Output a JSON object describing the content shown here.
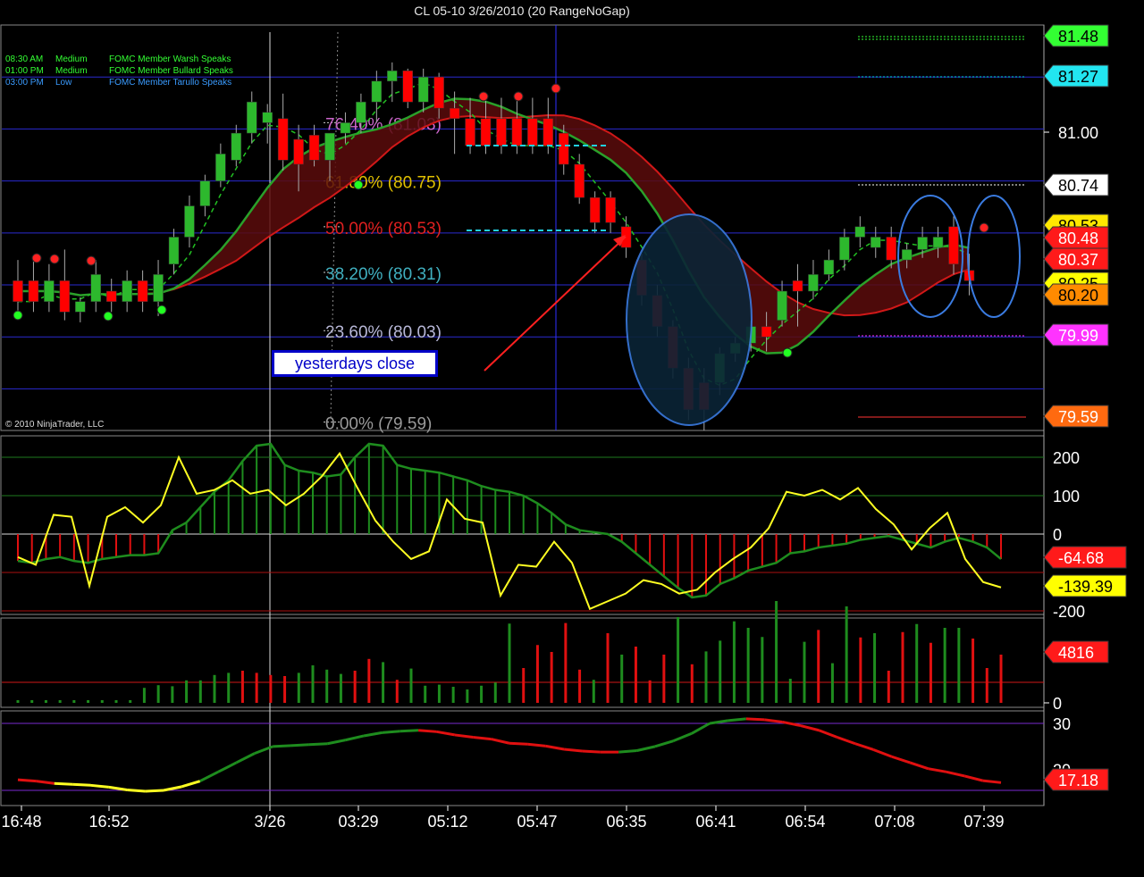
{
  "title": "CL 05-10  3/26/2010 (20 RangeNoGap)",
  "copyright": "© 2010 NinjaTrader, LLC",
  "yesterdays_close_label": "yesterdays close",
  "events": [
    {
      "time": "08:30 AM",
      "impact": "Medium",
      "text": "FOMC Member Warsh Speaks",
      "color": "#33ff33"
    },
    {
      "time": "01:00 PM",
      "impact": "Medium",
      "text": "FOMC Member Bullard Speaks",
      "color": "#33ff33"
    },
    {
      "time": "03:00 PM",
      "impact": "Low",
      "text": "FOMC Member Tarullo Speaks",
      "color": "#3a9bff"
    }
  ],
  "colors": {
    "up": "#2db82d",
    "down": "#ff0000",
    "accent_blue": "#3a9bff",
    "grid": "#2a2ad0"
  },
  "chart_data": [
    {
      "panel": "price",
      "type": "candlestick",
      "yticks": [
        "81.00",
        "79.75"
      ],
      "ylim": [
        79.55,
        81.5
      ],
      "xticks": [
        "16:48",
        "16:52",
        "3/26",
        "03:29",
        "05:12",
        "05:47",
        "06:35",
        "06:41",
        "06:54",
        "07:08",
        "07:39"
      ],
      "fib_levels": [
        {
          "label": "76.40% (81.03)",
          "value": 81.03,
          "color": "#cc66cc"
        },
        {
          "label": "61.80% (80.75)",
          "value": 80.75,
          "color": "#e0c000"
        },
        {
          "label": "50.00% (80.53)",
          "value": 80.53,
          "color": "#e02020"
        },
        {
          "label": "38.20% (80.31)",
          "value": 80.31,
          "color": "#40b0c0"
        },
        {
          "label": "23.60% (80.03)",
          "value": 80.03,
          "color": "#b8b8d8"
        },
        {
          "label": "0.00% (79.59)",
          "value": 79.59,
          "color": "#9a9a9a"
        }
      ],
      "price_labels": [
        {
          "text": "81.48",
          "bg": "#33ff33",
          "fg": "#000"
        },
        {
          "text": "81.27",
          "bg": "#22e5f0",
          "fg": "#000"
        },
        {
          "text": "81.00",
          "bg": "none",
          "fg": "#fff"
        },
        {
          "text": "80.74",
          "bg": "#ffffff",
          "fg": "#000"
        },
        {
          "text": "80.53",
          "bg": "#ffe800",
          "fg": "#000"
        },
        {
          "text": "80.48",
          "bg": "#ff1a1a",
          "fg": "#fff"
        },
        {
          "text": "80.37",
          "bg": "#ff1a1a",
          "fg": "#fff"
        },
        {
          "text": "80.25",
          "bg": "#ffff00",
          "fg": "#000"
        },
        {
          "text": "80.20",
          "bg": "#ff8a00",
          "fg": "#000"
        },
        {
          "text": "79.99",
          "bg": "#ff33ff",
          "fg": "#fff"
        },
        {
          "text": "79.59",
          "bg": "#ff6a10",
          "fg": "#fff"
        }
      ],
      "candles": [
        [
          80.27,
          80.37,
          80.12,
          80.17
        ],
        [
          80.27,
          80.37,
          80.12,
          80.17
        ],
        [
          80.17,
          80.35,
          80.12,
          80.27
        ],
        [
          80.27,
          80.42,
          80.08,
          80.12
        ],
        [
          80.12,
          80.19,
          80.07,
          80.17
        ],
        [
          80.17,
          80.37,
          80.12,
          80.3
        ],
        [
          80.22,
          80.28,
          80.12,
          80.17
        ],
        [
          80.17,
          80.32,
          80.12,
          80.27
        ],
        [
          80.27,
          80.32,
          80.12,
          80.17
        ],
        [
          80.17,
          80.37,
          80.1,
          80.3
        ],
        [
          80.35,
          80.52,
          80.3,
          80.48
        ],
        [
          80.48,
          80.68,
          80.43,
          80.63
        ],
        [
          80.63,
          80.78,
          80.58,
          80.75
        ],
        [
          80.75,
          80.93,
          80.72,
          80.88
        ],
        [
          80.85,
          81.02,
          80.82,
          80.98
        ],
        [
          80.98,
          81.18,
          80.93,
          81.13
        ],
        [
          81.03,
          81.12,
          80.93,
          81.08
        ],
        [
          81.05,
          81.17,
          80.8,
          80.85
        ],
        [
          80.95,
          81.02,
          80.7,
          80.83
        ],
        [
          80.97,
          81.02,
          80.82,
          80.85
        ],
        [
          80.85,
          80.97,
          80.75,
          80.98
        ],
        [
          80.98,
          81.08,
          80.93,
          81.03
        ],
        [
          81.03,
          81.17,
          80.98,
          81.13
        ],
        [
          81.13,
          81.28,
          81.03,
          81.23
        ],
        [
          81.23,
          81.32,
          81.13,
          81.28
        ],
        [
          81.28,
          81.29,
          81.1,
          81.13
        ],
        [
          81.13,
          81.29,
          81.08,
          81.25
        ],
        [
          81.25,
          81.27,
          81.05,
          81.1
        ],
        [
          81.1,
          81.18,
          80.88,
          81.05
        ],
        [
          81.05,
          81.15,
          80.88,
          80.92
        ],
        [
          81.05,
          81.15,
          80.88,
          80.92
        ],
        [
          81.05,
          81.15,
          80.88,
          80.92
        ],
        [
          81.05,
          81.15,
          80.88,
          80.92
        ],
        [
          81.05,
          81.15,
          80.88,
          80.92
        ],
        [
          81.05,
          81.15,
          80.88,
          80.92
        ],
        [
          80.98,
          81.02,
          80.78,
          80.83
        ],
        [
          80.83,
          80.88,
          80.64,
          80.67
        ],
        [
          80.67,
          80.7,
          80.5,
          80.55
        ],
        [
          80.67,
          80.7,
          80.5,
          80.55
        ],
        [
          80.53,
          80.58,
          80.38,
          80.43
        ],
        [
          80.37,
          80.4,
          80.15,
          80.2
        ],
        [
          80.2,
          80.25,
          80.0,
          80.05
        ],
        [
          80.05,
          80.08,
          79.8,
          79.85
        ],
        [
          79.85,
          79.9,
          79.6,
          79.65
        ],
        [
          79.78,
          79.85,
          79.55,
          79.65
        ],
        [
          79.78,
          79.95,
          79.72,
          79.92
        ],
        [
          79.92,
          80.0,
          79.88,
          79.97
        ],
        [
          79.97,
          80.08,
          79.93,
          80.05
        ],
        [
          80.05,
          80.12,
          79.93,
          80.0
        ],
        [
          80.08,
          80.27,
          80.05,
          80.22
        ],
        [
          80.27,
          80.35,
          80.05,
          80.22
        ],
        [
          80.22,
          80.37,
          80.18,
          80.3
        ],
        [
          80.3,
          80.42,
          80.27,
          80.37
        ],
        [
          80.37,
          80.52,
          80.32,
          80.48
        ],
        [
          80.48,
          80.58,
          80.43,
          80.53
        ],
        [
          80.43,
          80.53,
          80.38,
          80.48
        ],
        [
          80.48,
          80.53,
          80.33,
          80.37
        ],
        [
          80.37,
          80.45,
          80.33,
          80.42
        ],
        [
          80.42,
          80.53,
          80.38,
          80.48
        ],
        [
          80.43,
          80.53,
          80.38,
          80.48
        ],
        [
          80.53,
          80.58,
          80.3,
          80.35
        ],
        [
          80.32,
          80.4,
          80.2,
          80.27
        ]
      ],
      "moving_averages": [
        {
          "name": "fast",
          "color": "#ff2020",
          "style": "dashed"
        },
        {
          "name": "slow",
          "color": "#2db82d",
          "style": "solid"
        },
        {
          "name": "ribbon",
          "color": "#cc1010",
          "style": "solid"
        }
      ]
    },
    {
      "panel": "oscillator",
      "type": "line",
      "yticks": [
        "200",
        "100",
        "0",
        "-200"
      ],
      "ylim": [
        -200,
        240
      ],
      "labels": [
        {
          "text": "-64.68",
          "bg": "#ff1a1a",
          "fg": "#fff"
        },
        {
          "text": "-139.39",
          "bg": "#ffff00",
          "fg": "#000"
        }
      ],
      "histogram": [
        -70,
        -75,
        -65,
        -60,
        -70,
        -75,
        -65,
        -60,
        -55,
        -55,
        -50,
        10,
        30,
        70,
        110,
        140,
        190,
        230,
        235,
        180,
        165,
        160,
        150,
        155,
        200,
        235,
        230,
        180,
        170,
        165,
        160,
        150,
        140,
        125,
        115,
        110,
        100,
        80,
        55,
        25,
        10,
        5,
        0,
        -20,
        -50,
        -80,
        -110,
        -140,
        -165,
        -160,
        -130,
        -115,
        -95,
        -85,
        -75,
        -50,
        -45,
        -35,
        -30,
        -25,
        -15,
        -10,
        -5,
        -15,
        -25,
        -35,
        -20,
        -10,
        -20,
        -35,
        -65
      ],
      "line": [
        -60,
        -80,
        50,
        45,
        -135,
        45,
        70,
        30,
        75,
        200,
        105,
        115,
        140,
        105,
        115,
        75,
        105,
        150,
        210,
        120,
        35,
        -20,
        -65,
        -45,
        90,
        40,
        30,
        -160,
        -80,
        -85,
        -20,
        -75,
        -195,
        -175,
        -155,
        -120,
        -130,
        -155,
        -145,
        -100,
        -65,
        -35,
        15,
        110,
        100,
        115,
        90,
        120,
        65,
        25,
        -40,
        15,
        55,
        -65,
        -125,
        -139
      ]
    },
    {
      "panel": "volume",
      "type": "bar",
      "yticks": [
        "0"
      ],
      "labels": [
        {
          "text": "4816",
          "bg": "#ff1a1a",
          "fg": "#fff"
        }
      ],
      "values": [
        50,
        50,
        50,
        50,
        50,
        50,
        50,
        50,
        50,
        280,
        330,
        310,
        420,
        420,
        520,
        560,
        600,
        560,
        520,
        500,
        560,
        700,
        620,
        540,
        600,
        820,
        760,
        430,
        640,
        320,
        340,
        300,
        250,
        320,
        380,
        1480,
        650,
        1080,
        950,
        1490,
        620,
        430,
        1300,
        900,
        1050,
        420,
        900,
        1600,
        720,
        960,
        1160,
        1520,
        1400,
        1230,
        1900,
        450,
        1140,
        1360,
        740,
        1800,
        1220,
        1300,
        600,
        1320,
        1470,
        1120,
        1400,
        1400,
        1200,
        650,
        900
      ],
      "colors_up_down": [
        1,
        1,
        1,
        1,
        1,
        1,
        1,
        1,
        1,
        1,
        1,
        1,
        1,
        1,
        1,
        1,
        0,
        0,
        0,
        0,
        1,
        1,
        1,
        1,
        0,
        0,
        1,
        0,
        1,
        1,
        1,
        1,
        1,
        1,
        1,
        1,
        0,
        0,
        0,
        0,
        0,
        1,
        0,
        1,
        0,
        0,
        0,
        1,
        0,
        1,
        1,
        1,
        1,
        1,
        1,
        1,
        1,
        0,
        1,
        1,
        0,
        1,
        0,
        0,
        1,
        0,
        1,
        1,
        0,
        0,
        0
      ]
    },
    {
      "panel": "trend",
      "type": "line",
      "yticks": [
        "30",
        "20"
      ],
      "ylim": [
        15,
        32
      ],
      "labels": [
        {
          "text": "17.18",
          "bg": "#ff1a1a",
          "fg": "#fff"
        }
      ],
      "values": [
        17.8,
        17.5,
        17.0,
        16.8,
        16.6,
        16.2,
        15.6,
        15.3,
        15.5,
        16.3,
        17.5,
        19.5,
        21.5,
        23.5,
        25.0,
        25.2,
        25.4,
        25.6,
        26.4,
        27.3,
        28.0,
        28.3,
        28.5,
        28.2,
        27.5,
        27.0,
        26.6,
        25.7,
        25.5,
        25.1,
        24.4,
        24.0,
        23.8,
        23.8,
        24.1,
        25.0,
        26.2,
        27.8,
        30.0,
        30.6,
        31.0,
        30.8,
        30.3,
        29.5,
        28.5,
        27.0,
        25.6,
        24.3,
        22.8,
        21.5,
        20.2,
        19.5,
        18.6,
        17.6,
        17.18
      ]
    }
  ]
}
